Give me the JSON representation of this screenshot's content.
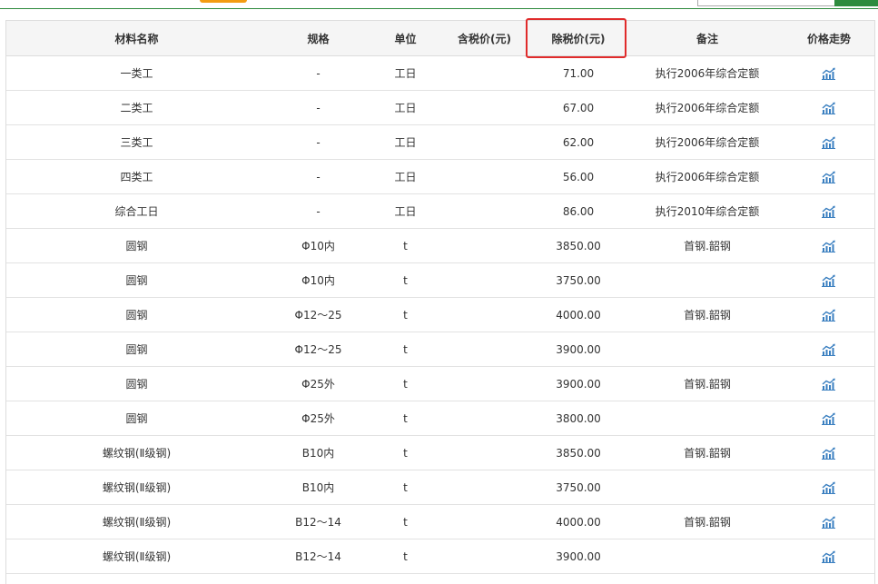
{
  "headers": {
    "name": "材料名称",
    "spec": "规格",
    "unit": "单位",
    "tax_incl": "含税价(元)",
    "tax_excl": "除税价(元)",
    "note": "备注",
    "trend": "价格走势"
  },
  "rows": [
    {
      "name": "一类工",
      "spec": "-",
      "unit": "工日",
      "tax_incl": "",
      "tax_excl": "71.00",
      "note": "执行2006年综合定额"
    },
    {
      "name": "二类工",
      "spec": "-",
      "unit": "工日",
      "tax_incl": "",
      "tax_excl": "67.00",
      "note": "执行2006年综合定额"
    },
    {
      "name": "三类工",
      "spec": "-",
      "unit": "工日",
      "tax_incl": "",
      "tax_excl": "62.00",
      "note": "执行2006年综合定额"
    },
    {
      "name": "四类工",
      "spec": "-",
      "unit": "工日",
      "tax_incl": "",
      "tax_excl": "56.00",
      "note": "执行2006年综合定额"
    },
    {
      "name": "综合工日",
      "spec": "-",
      "unit": "工日",
      "tax_incl": "",
      "tax_excl": "86.00",
      "note": "执行2010年综合定额"
    },
    {
      "name": "圆钢",
      "spec": "Φ10内",
      "unit": "t",
      "tax_incl": "",
      "tax_excl": "3850.00",
      "note": "首钢.韶钢"
    },
    {
      "name": "圆钢",
      "spec": "Φ10内",
      "unit": "t",
      "tax_incl": "",
      "tax_excl": "3750.00",
      "note": ""
    },
    {
      "name": "圆钢",
      "spec": "Φ12～25",
      "unit": "t",
      "tax_incl": "",
      "tax_excl": "4000.00",
      "note": "首钢.韶钢"
    },
    {
      "name": "圆钢",
      "spec": "Φ12～25",
      "unit": "t",
      "tax_incl": "",
      "tax_excl": "3900.00",
      "note": ""
    },
    {
      "name": "圆钢",
      "spec": "Φ25外",
      "unit": "t",
      "tax_incl": "",
      "tax_excl": "3900.00",
      "note": "首钢.韶钢"
    },
    {
      "name": "圆钢",
      "spec": "Φ25外",
      "unit": "t",
      "tax_incl": "",
      "tax_excl": "3800.00",
      "note": ""
    },
    {
      "name": "螺纹钢(Ⅱ级钢)",
      "spec": "B10内",
      "unit": "t",
      "tax_incl": "",
      "tax_excl": "3850.00",
      "note": "首钢.韶钢"
    },
    {
      "name": "螺纹钢(Ⅱ级钢)",
      "spec": "B10内",
      "unit": "t",
      "tax_incl": "",
      "tax_excl": "3750.00",
      "note": ""
    },
    {
      "name": "螺纹钢(Ⅱ级钢)",
      "spec": "B12～14",
      "unit": "t",
      "tax_incl": "",
      "tax_excl": "4000.00",
      "note": "首钢.韶钢"
    },
    {
      "name": "螺纹钢(Ⅱ级钢)",
      "spec": "B12～14",
      "unit": "t",
      "tax_incl": "",
      "tax_excl": "3900.00",
      "note": ""
    }
  ],
  "icons": {
    "trend": "trend-chart-icon"
  },
  "colors": {
    "accent_green": "#2e8b3e",
    "highlight_red": "#e02b2b",
    "icon_blue": "#3a7fc0",
    "tab_orange": "#f39c12"
  }
}
